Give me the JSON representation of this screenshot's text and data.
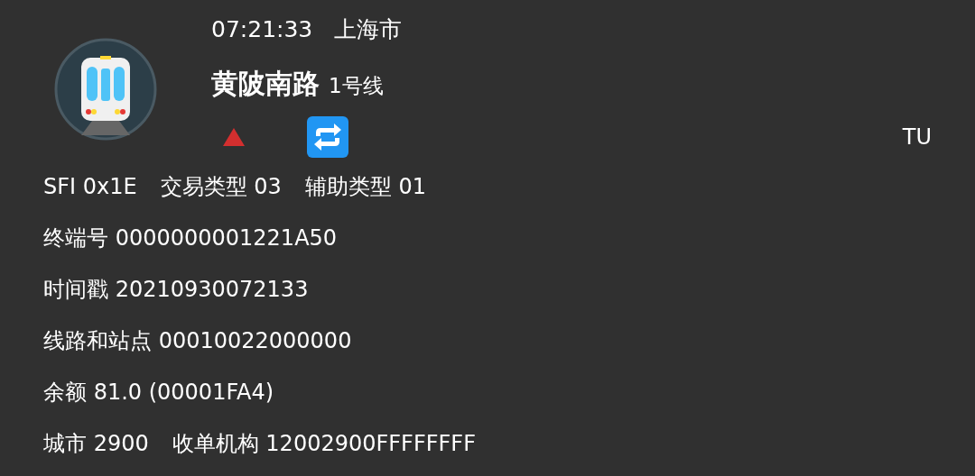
{
  "header": {
    "time": "07:21:33",
    "city": "上海市",
    "station": "黄陂南路",
    "line": "1号线",
    "tag": "TU"
  },
  "fields": [
    [
      "SFI 0x1E",
      "交易类型 03",
      "辅助类型 01"
    ],
    [
      "终端号 0000000001221A50"
    ],
    [
      "时间戳 20210930072133"
    ],
    [
      "线路和站点 00010022000000"
    ],
    [
      "余额 81.0 (00001FA4)"
    ],
    [
      "城市 2900",
      "收单机构 12002900FFFFFFFF"
    ]
  ]
}
